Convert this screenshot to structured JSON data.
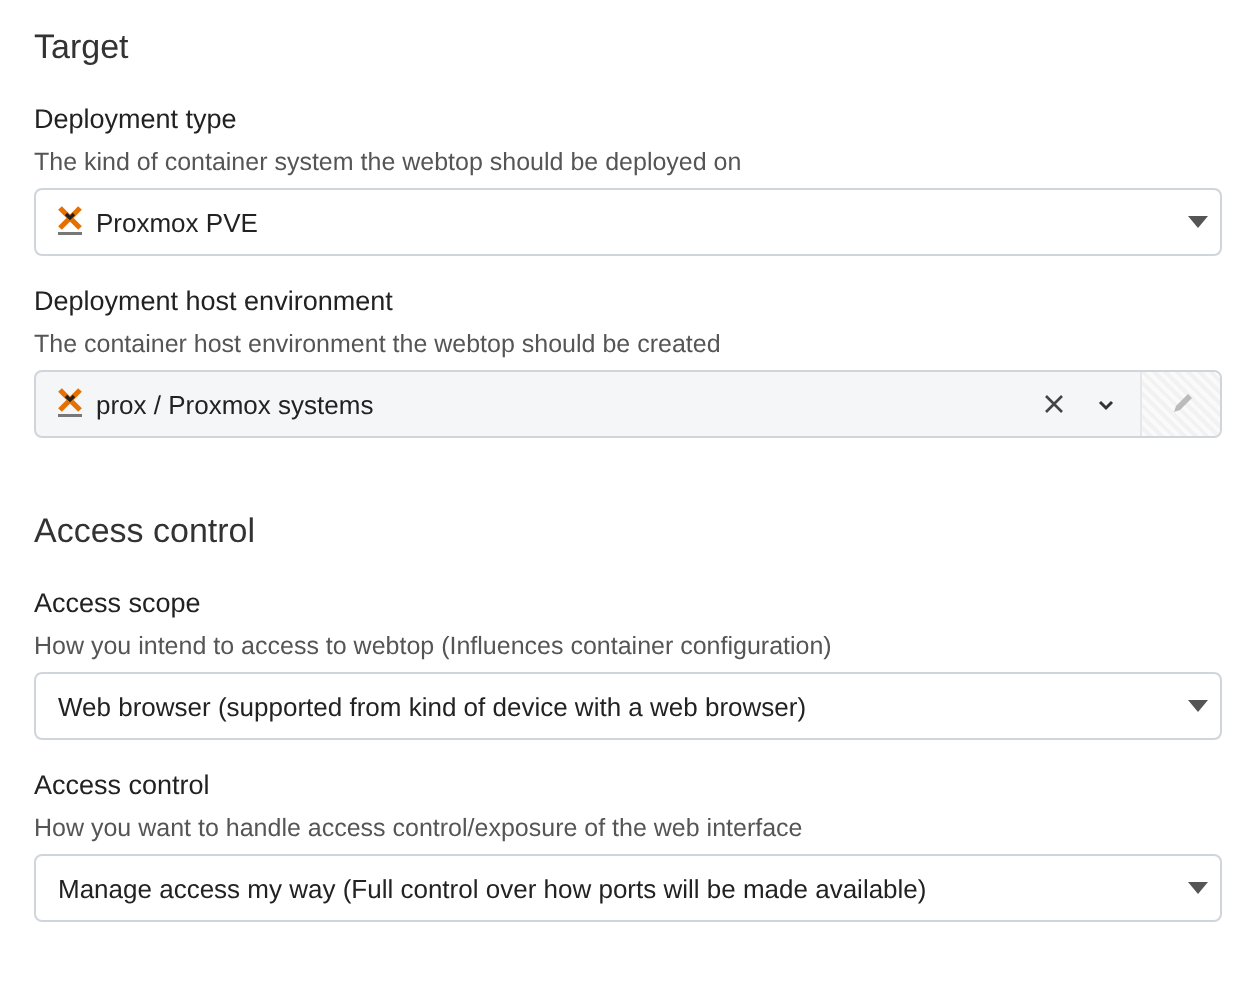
{
  "sections": [
    {
      "title": "Target",
      "fields": [
        {
          "kind": "select",
          "label": "Deployment type",
          "hint": "The kind of container system the webtop should be deployed on",
          "value": "Proxmox PVE",
          "logo": true
        },
        {
          "kind": "combobox",
          "label": "Deployment host environment",
          "hint": "The container host environment the webtop should be created",
          "value": "prox / Proxmox systems",
          "logo": true
        }
      ]
    },
    {
      "title": "Access control",
      "fields": [
        {
          "kind": "select",
          "label": "Access scope",
          "hint": "How you intend to access to webtop (Influences container configuration)",
          "value": "Web browser (supported from kind of device with a web browser)",
          "logo": false
        },
        {
          "kind": "select",
          "label": "Access control",
          "hint": "How you want to handle access control/exposure of the web interface",
          "value": "Manage access my way (Full control over how ports will be made available)",
          "logo": false
        }
      ]
    }
  ]
}
